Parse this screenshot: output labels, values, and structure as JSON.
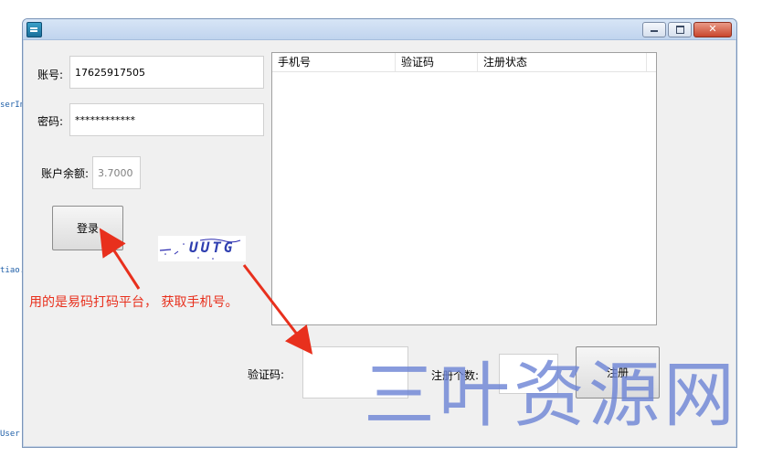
{
  "left_code": [
    "serIn",
    "tiao.",
    "User"
  ],
  "window": {
    "buttons": {
      "minimize": "",
      "maximize": "",
      "close": "✕"
    }
  },
  "form": {
    "account_label": "账号:",
    "account_value": "17625917505",
    "password_label": "密码:",
    "password_value": "************",
    "balance_label": "账户余额:",
    "balance_value": "3.7000",
    "login_button": "登录"
  },
  "captcha_text": "UUTG",
  "annotation": "用的是易码打码平台， 获取手机号。",
  "table": {
    "columns": [
      "手机号",
      "验证码",
      "注册状态"
    ],
    "rows": []
  },
  "bottom": {
    "code_label": "验证码:",
    "code_value": "",
    "count_label": "注册个数:",
    "count_value": "",
    "register_button": "注册"
  },
  "watermark": "三叶资源网",
  "colors": {
    "annotation": "#e8301d",
    "watermark": "#6f86d6",
    "window_border": "#7b95b8"
  },
  "icons": [
    "app-icon",
    "minimize-icon",
    "maximize-icon",
    "close-icon",
    "arrow-icon"
  ]
}
